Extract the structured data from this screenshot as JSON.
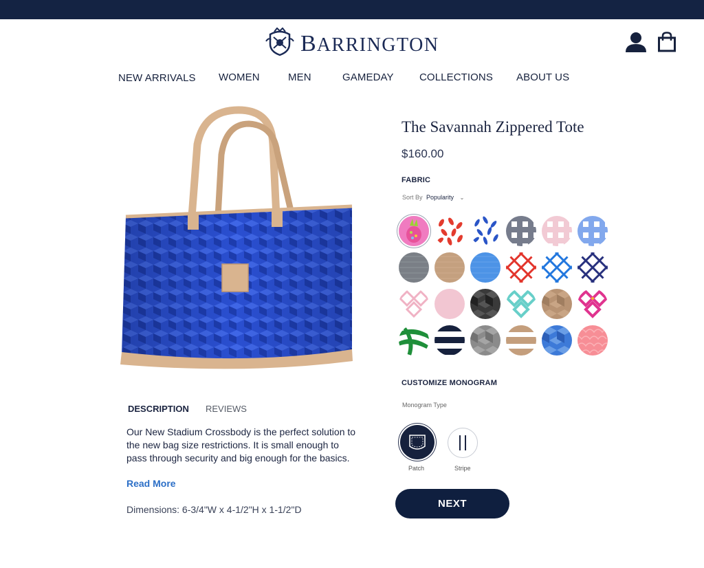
{
  "header": {
    "brand": "Barrington",
    "brand_initial": "B",
    "brand_rest": "ARRINGTON"
  },
  "nav": {
    "items": [
      "NEW ARRIVALS",
      "WOMEN",
      "MEN",
      "GAMEDAY",
      "COLLECTIONS",
      "ABOUT US"
    ]
  },
  "product": {
    "title": "The Savannah Zippered Tote",
    "price": "$160.00",
    "image_colors": {
      "body": "#2a4fd1",
      "trim": "#d9b48f"
    }
  },
  "fabric": {
    "label": "FABRIC",
    "sort_label": "Sort By",
    "sort_value": "Popularity",
    "swatch_icons": [
      "pineapple-swatch",
      "red-leaf-swatch",
      "blue-leaf-swatch",
      "navy-gingham-swatch",
      "pink-gingham-swatch",
      "blue-gingham-swatch",
      "grey-linen-swatch",
      "tan-linen-swatch",
      "blue-linen-swatch",
      "red-fret-swatch",
      "blue-fret-swatch",
      "navy-fret-swatch",
      "pink-ikat-swatch",
      "pink-solid-swatch",
      "black-cube-swatch",
      "aqua-ikat-swatch",
      "tan-cube-swatch",
      "magenta-ikat-swatch",
      "green-palm-swatch",
      "navy-stripe-swatch",
      "grey-cube-swatch",
      "tan-stripe-swatch",
      "blue-cube-swatch",
      "coral-scale-swatch"
    ]
  },
  "monogram": {
    "label": "CUSTOMIZE MONOGRAM",
    "type_label": "Monogram Type",
    "options": [
      {
        "label": "Patch"
      },
      {
        "label": "Stripe"
      }
    ]
  },
  "details": {
    "tabs": [
      "DESCRIPTION",
      "REVIEWS"
    ],
    "description": "Our New Stadium Crossbody is the perfect solution to the new bag size restrictions. It is small enough to pass through security and big enough for the basics.",
    "read_more": "Read More",
    "dimensions": "Dimensions: 6-3/4\"W x 4-1/2\"H x 1-1/2\"D"
  },
  "cta": {
    "next": "NEXT"
  }
}
